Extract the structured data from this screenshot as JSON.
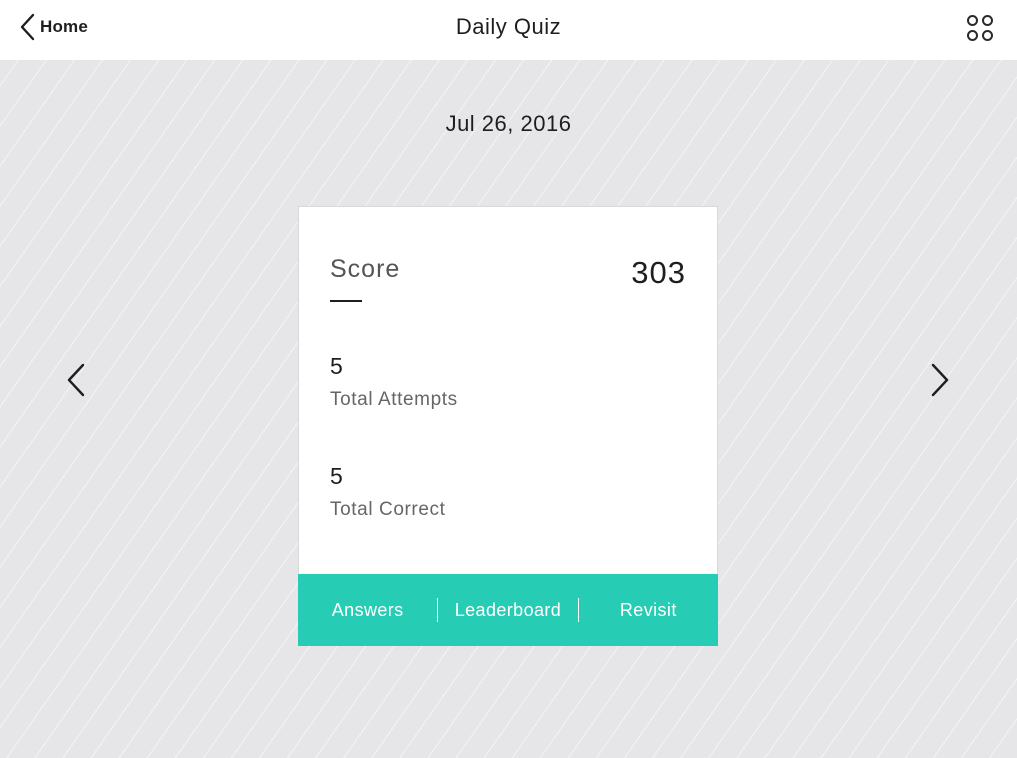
{
  "header": {
    "back_label": "Home",
    "title": "Daily Quiz",
    "back_icon": "chevron-left-icon",
    "menu_icon": "grid-icon"
  },
  "date": "Jul 26, 2016",
  "card": {
    "score_label": "Score",
    "score_value": "303",
    "stats": [
      {
        "value": "5",
        "label": "Total Attempts"
      },
      {
        "value": "5",
        "label": "Total Correct"
      }
    ],
    "actions": [
      {
        "label": "Answers"
      },
      {
        "label": "Leaderboard"
      },
      {
        "label": "Revisit"
      }
    ]
  },
  "navigation": {
    "prev_icon": "chevron-left-icon",
    "next_icon": "chevron-right-icon"
  },
  "colors": {
    "accent": "#27ccb4",
    "background": "#e6e6e8",
    "card": "#ffffff",
    "text": "#1e1e1e"
  }
}
